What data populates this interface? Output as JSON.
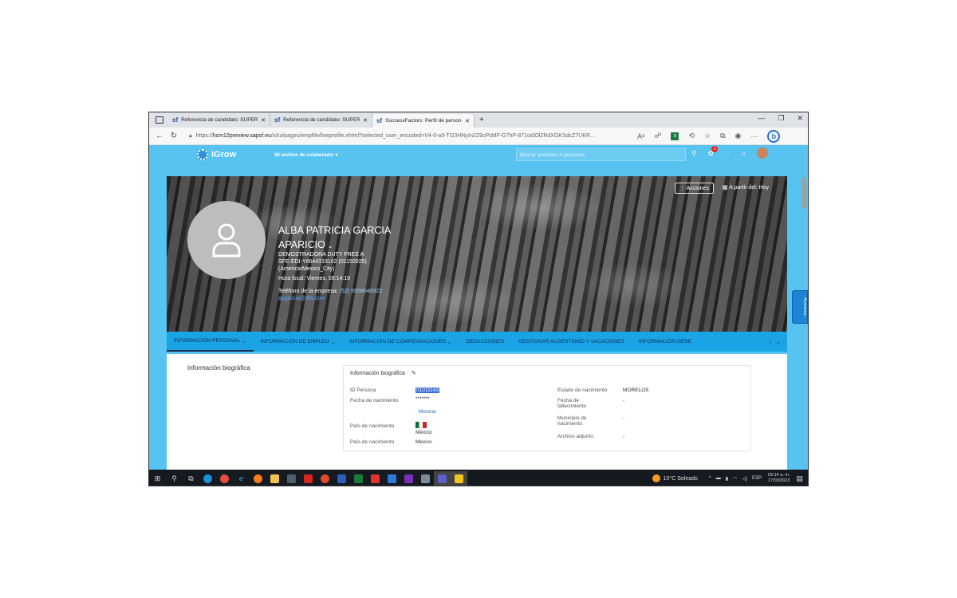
{
  "browser": {
    "tabs": [
      {
        "title": "Referencia de candidato: SUPERI"
      },
      {
        "title": "Referencia de candidato: SUPERI"
      },
      {
        "title": "SuccessFactors: Perfil de persona"
      }
    ],
    "url_prefix": "https://",
    "url_host": "hcm12preview.sapsf.eu",
    "url_rest": "/xi/ui/pages/empfile/liveprofile.xhtml?selected_user_encoded=V4-0-a9-TI23HNyIn2Z9cPsMF-G7hP-871oi0Ol2RdXGKSdcZ7UKR..."
  },
  "app": {
    "logo_text": "iGrow",
    "menu_label": "Mi archivo de colaborador",
    "search_placeholder": "Buscar acciones o personas",
    "notification_count": "1",
    "actions_label": "Acciones",
    "date_label": "A partir del: Hoy",
    "side_tab_label": "Acciones..."
  },
  "profile": {
    "name_line1": "ALBA PATRICIA GARCIA",
    "name_line2": "APARICIO",
    "company": "DEMOSTRADORA DUTY FREE A",
    "code": "SFE-EDI-Y6644319102 (01150025)",
    "timezone": "(America/Mexico_City)",
    "local_time": "Hora local: Viernes, 09:14:16",
    "phone_label": "Teléfono de la empresa:",
    "phone_value": "(52) 5558040922",
    "email": "apgarcia@dfa.com"
  },
  "section_tabs": [
    "INFORMACIÓN PERSONAL",
    "INFORMACIÓN DE EMPLEO",
    "INFORMACIÓN DE COMPENSACIONES",
    "DEDUCCIONES",
    "GESTIONAR AUSENTISMO Y VACACIONES",
    "INFORMACIÓN GENE"
  ],
  "bio": {
    "section_title": "Información biográfica",
    "card_title": "Información biográfica",
    "left": {
      "id_label": "ID Persona",
      "id_value": "01011143",
      "dob_label": "Fecha de nacimiento",
      "dob_value": "*******",
      "show_link": "Mostrar",
      "country_label_1": "País de nacimiento",
      "country_value_1": "México",
      "country_label_2": "País de nacimiento",
      "country_value_2": "Mexico"
    },
    "right": {
      "state_label": "Estado de nacimiento",
      "state_value": "MORELOS",
      "death_label_1": "Fecha de",
      "death_label_2": "fallecimiento",
      "death_value": "-",
      "mun_label_1": "Municipio de",
      "mun_label_2": "nacimiento",
      "mun_value": "-",
      "attach_label": "Archivo adjunto",
      "attach_value": "-"
    }
  },
  "taskbar": {
    "weather": "10°C  Soleado",
    "lang": "ESP",
    "time": "09:14 a. m.",
    "date": "17/03/2023"
  }
}
